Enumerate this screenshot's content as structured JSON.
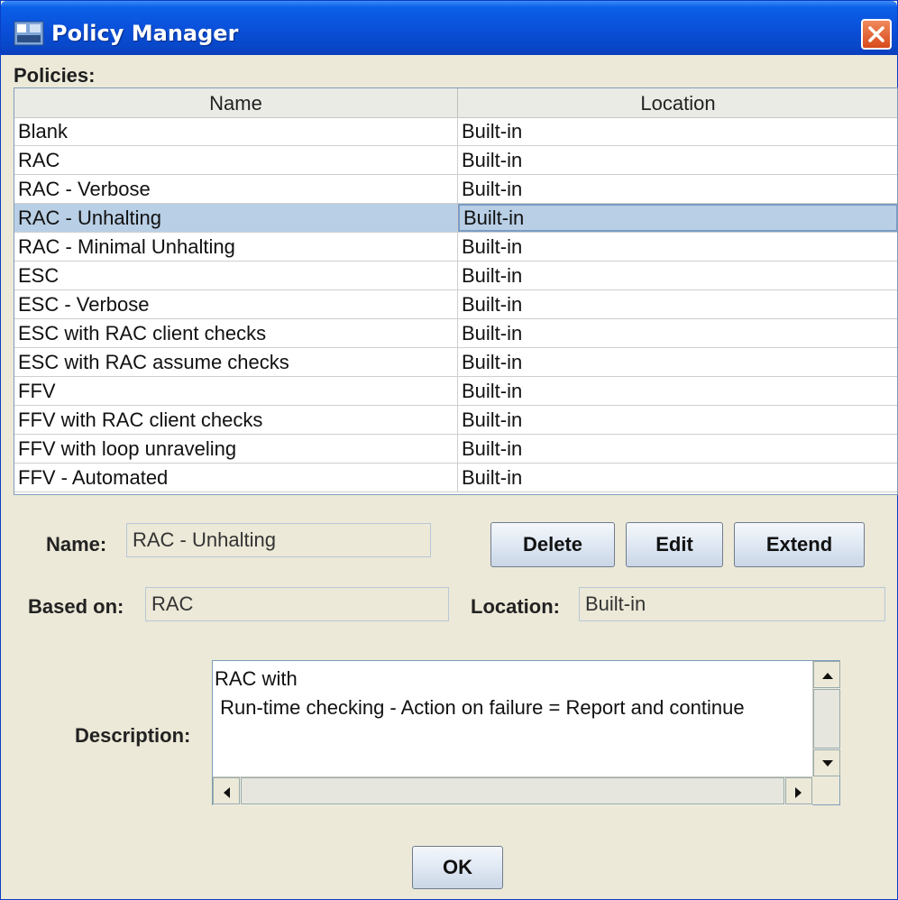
{
  "window": {
    "title": "Policy Manager"
  },
  "policies": {
    "section_label": "Policies:",
    "columns": [
      "Name",
      "Location"
    ],
    "rows": [
      {
        "name": "Blank",
        "location": "Built-in"
      },
      {
        "name": "RAC",
        "location": "Built-in"
      },
      {
        "name": "RAC - Verbose",
        "location": "Built-in"
      },
      {
        "name": "RAC - Unhalting",
        "location": "Built-in",
        "selected": true
      },
      {
        "name": "RAC - Minimal Unhalting",
        "location": "Built-in"
      },
      {
        "name": "ESC",
        "location": "Built-in"
      },
      {
        "name": "ESC - Verbose",
        "location": "Built-in"
      },
      {
        "name": "ESC with RAC client checks",
        "location": "Built-in"
      },
      {
        "name": "ESC with RAC assume checks",
        "location": "Built-in"
      },
      {
        "name": "FFV",
        "location": "Built-in"
      },
      {
        "name": "FFV with RAC client checks",
        "location": "Built-in"
      },
      {
        "name": "FFV with loop unraveling",
        "location": "Built-in"
      },
      {
        "name": "FFV - Automated",
        "location": "Built-in"
      }
    ]
  },
  "details": {
    "name_label": "Name:",
    "name_value": "RAC - Unhalting",
    "based_on_label": "Based on:",
    "based_on_value": "RAC",
    "location_label": "Location:",
    "location_value": "Built-in",
    "description_label": "Description:",
    "description_text": "RAC with\n Run-time checking - Action on failure = Report and continue"
  },
  "buttons": {
    "delete": "Delete",
    "edit": "Edit",
    "extend": "Extend",
    "ok": "OK"
  },
  "colors": {
    "title_bar": "#0a4fd8",
    "selection": "#b8cfe5",
    "close_button": "#d84a1c"
  }
}
